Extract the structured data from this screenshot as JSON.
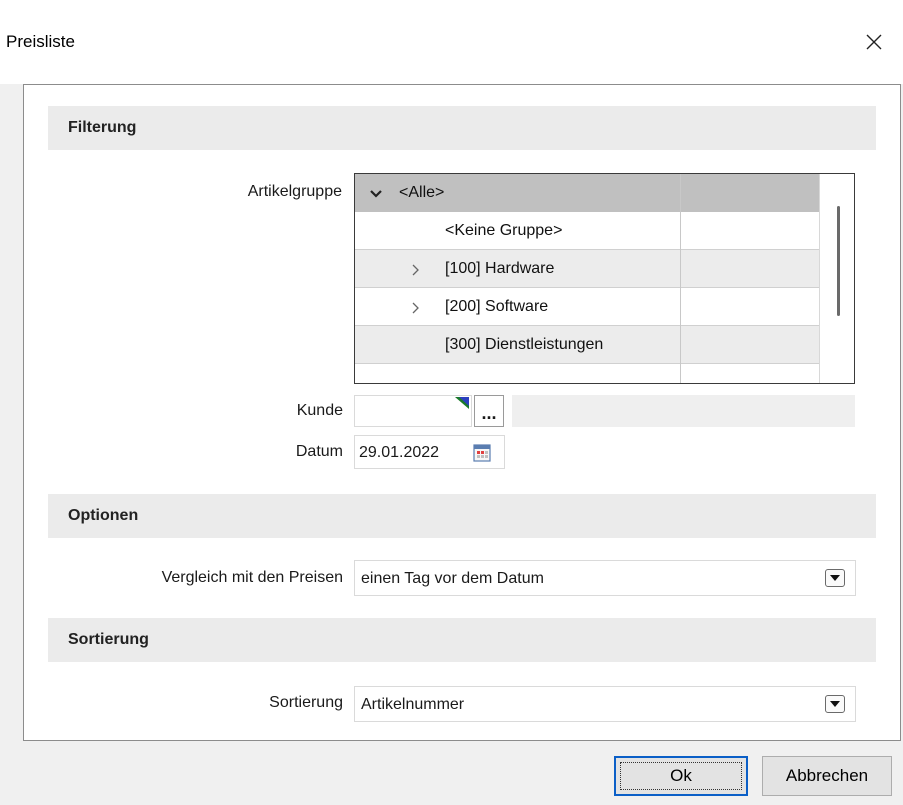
{
  "window": {
    "title": "Preisliste"
  },
  "sections": {
    "filterung": "Filterung",
    "optionen": "Optionen",
    "sortierung": "Sortierung"
  },
  "artikelgruppe": {
    "label": "Artikelgruppe",
    "items": [
      {
        "label": "<Alle>",
        "expander": "expanded",
        "selected": true
      },
      {
        "label": "<Keine Gruppe>",
        "expander": "none",
        "selected": false
      },
      {
        "label": "[100] Hardware",
        "expander": "collapsed",
        "selected": false
      },
      {
        "label": "[200] Software",
        "expander": "collapsed",
        "selected": false
      },
      {
        "label": "[300] Dienstleistungen",
        "expander": "none",
        "selected": false
      }
    ]
  },
  "kunde": {
    "label": "Kunde",
    "value": "",
    "browse_label": "..."
  },
  "datum": {
    "label": "Datum",
    "value": "29.01.2022"
  },
  "vergleich": {
    "label": "Vergleich mit den Preisen",
    "value": "einen Tag vor dem Datum"
  },
  "sortierung": {
    "label": "Sortierung",
    "value": "Artikelnummer"
  },
  "buttons": {
    "ok": "Ok",
    "cancel": "Abbrechen"
  },
  "colors": {
    "accent": "#0b5fc7",
    "section_bg": "#ebebeb",
    "selected_row": "#c0c0c0"
  }
}
